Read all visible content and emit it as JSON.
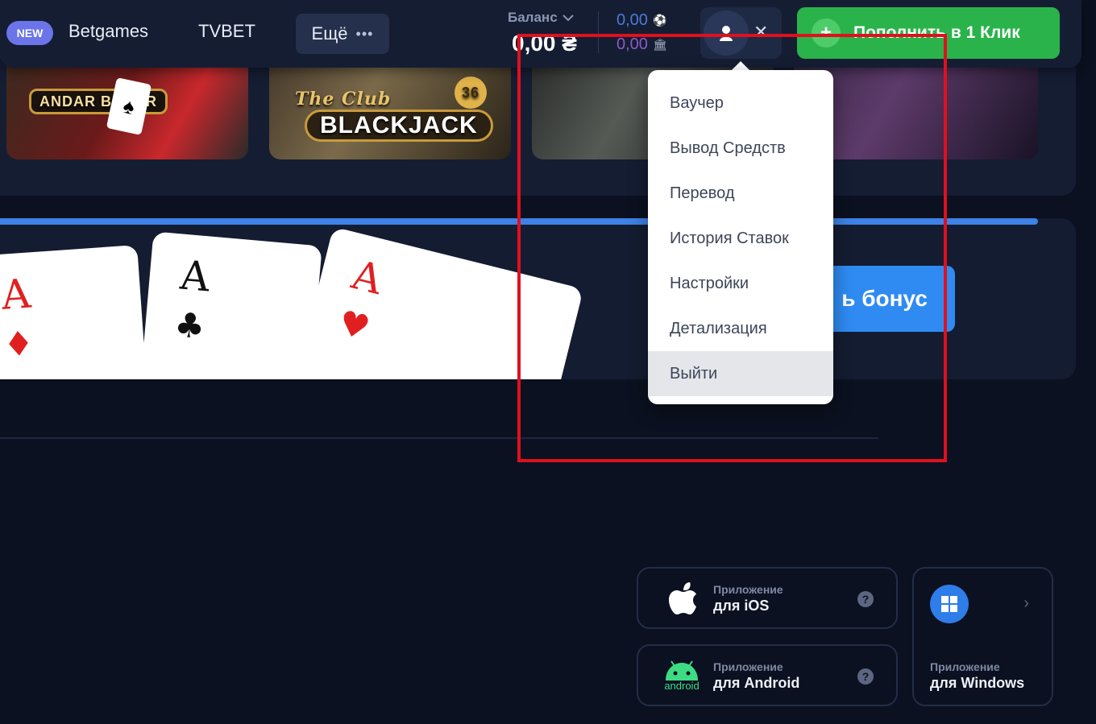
{
  "header": {
    "new_badge": "NEW",
    "nav": [
      {
        "label": "Betgames"
      },
      {
        "label": "TVBET"
      }
    ],
    "more_label": "Ещё",
    "balance_label": "Баланс",
    "balance_value": "0,00 ₴",
    "sub_balances": [
      {
        "value": "0,00",
        "icon": "soccer-ball-icon"
      },
      {
        "value": "0,00",
        "icon": "bank-icon"
      }
    ],
    "deposit_label": "Пополнить в 1 Клик"
  },
  "games": [
    {
      "logo": "ANDAR BAHAR"
    },
    {
      "logo_script": "The Club",
      "logo": "BLACKJACK",
      "badge": "36"
    },
    {
      "logo": ""
    },
    {
      "logo": ""
    }
  ],
  "promo": {
    "bonus_button": "ь бонус",
    "cards": [
      {
        "rank": "A",
        "suit": "♦"
      },
      {
        "rank": "A",
        "suit": "♣"
      },
      {
        "rank": "A",
        "suit": "♥"
      }
    ]
  },
  "user_menu": {
    "items": [
      {
        "label": "Ваучер"
      },
      {
        "label": "Вывод Средств"
      },
      {
        "label": "Перевод"
      },
      {
        "label": "История Ставок"
      },
      {
        "label": "Настройки"
      },
      {
        "label": "Детализация"
      },
      {
        "label": "Выйти"
      }
    ],
    "active_index": 6
  },
  "apps": {
    "ios": {
      "sub": "Приложение",
      "name": "для iOS"
    },
    "android": {
      "sub": "Приложение",
      "name": "для Android",
      "logo_text": "android"
    },
    "windows": {
      "sub": "Приложение",
      "name": "для Windows"
    }
  },
  "colors": {
    "background": "#0b1120",
    "panel": "#151d33",
    "deposit_green": "#2ab34a",
    "bonus_blue": "#2f8bf2",
    "highlight_red": "#e0101e"
  }
}
